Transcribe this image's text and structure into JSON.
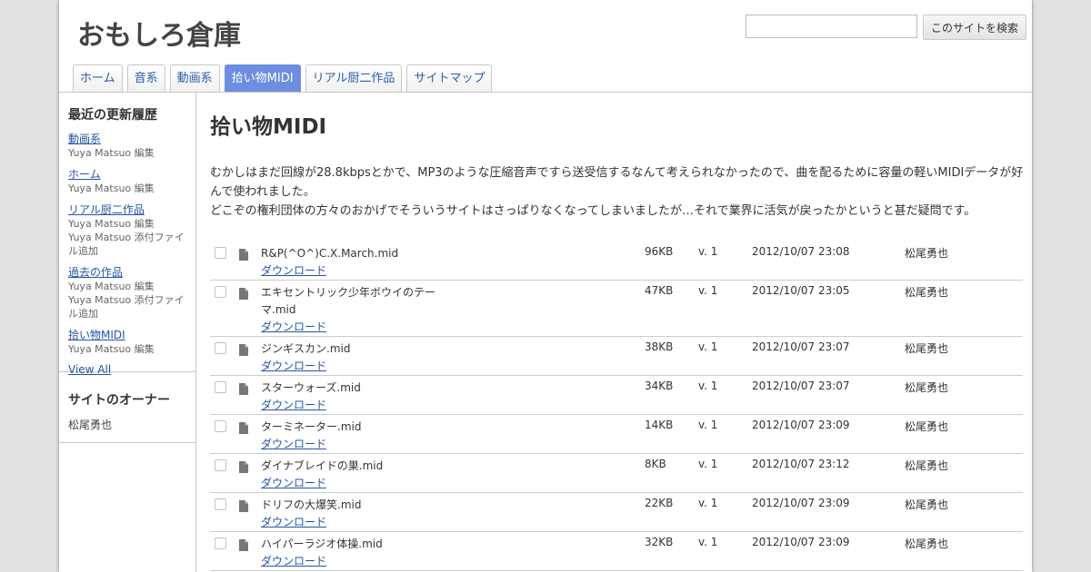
{
  "site": {
    "title": "おもしろ倉庫"
  },
  "search": {
    "placeholder": "",
    "button_label": "このサイトを検索"
  },
  "tabs": [
    {
      "label": "ホーム",
      "active": false
    },
    {
      "label": "音系",
      "active": false
    },
    {
      "label": "動画系",
      "active": false
    },
    {
      "label": "拾い物MIDI",
      "active": true
    },
    {
      "label": "リアル厨二作品",
      "active": false
    },
    {
      "label": "サイトマップ",
      "active": false
    }
  ],
  "sidebar": {
    "recent_title": "最近の更新履歴",
    "recent": [
      {
        "link": "動画系",
        "notes": [
          "Yuya Matsuo 編集"
        ]
      },
      {
        "link": "ホーム",
        "notes": [
          "Yuya Matsuo 編集"
        ]
      },
      {
        "link": "リアル厨二作品",
        "notes": [
          "Yuya Matsuo 編集",
          "Yuya Matsuo 添付ファイル追加"
        ]
      },
      {
        "link": "過去の作品",
        "notes": [
          "Yuya Matsuo 編集",
          "Yuya Matsuo 添付ファイル追加"
        ]
      },
      {
        "link": "拾い物MIDI",
        "notes": [
          "Yuya Matsuo 編集"
        ]
      }
    ],
    "view_all": "View All",
    "owner_title": "サイトのオーナー",
    "owner_name": "松尾勇也"
  },
  "main": {
    "title": "拾い物MIDI",
    "desc1": "むかしはまだ回線が28.8kbpsとかで、MP3のような圧縮音声ですら送受信するなんて考えられなかったので、曲を配るために容量の軽いMIDIデータが好んで使われました。",
    "desc2": "どこぞの権利団体の方々のおかげでそういうサイトはさっぱりなくなってしまいましたが…それで業界に活気が戻ったかというと甚だ疑問です。",
    "download_label": "ダウンロード",
    "files": [
      {
        "name": "R&P(^O^)C.X.March.mid",
        "size": "96KB",
        "version": "v. 1",
        "date": "2012/10/07 23:08",
        "user": "松尾勇也"
      },
      {
        "name": "エキセントリック少年ボウイのテーマ.mid",
        "size": "47KB",
        "version": "v. 1",
        "date": "2012/10/07 23:05",
        "user": "松尾勇也"
      },
      {
        "name": "ジンギスカン.mid",
        "size": "38KB",
        "version": "v. 1",
        "date": "2012/10/07 23:07",
        "user": "松尾勇也"
      },
      {
        "name": "スターウォーズ.mid",
        "size": "34KB",
        "version": "v. 1",
        "date": "2012/10/07 23:07",
        "user": "松尾勇也"
      },
      {
        "name": "ターミネーター.mid",
        "size": "14KB",
        "version": "v. 1",
        "date": "2012/10/07 23:09",
        "user": "松尾勇也"
      },
      {
        "name": "ダイナブレイドの巣.mid",
        "size": "8KB",
        "version": "v. 1",
        "date": "2012/10/07 23:12",
        "user": "松尾勇也"
      },
      {
        "name": "ドリフの大爆笑.mid",
        "size": "22KB",
        "version": "v. 1",
        "date": "2012/10/07 23:09",
        "user": "松尾勇也"
      },
      {
        "name": "ハイパーラジオ体操.mid",
        "size": "32KB",
        "version": "v. 1",
        "date": "2012/10/07 23:09",
        "user": "松尾勇也"
      }
    ]
  }
}
